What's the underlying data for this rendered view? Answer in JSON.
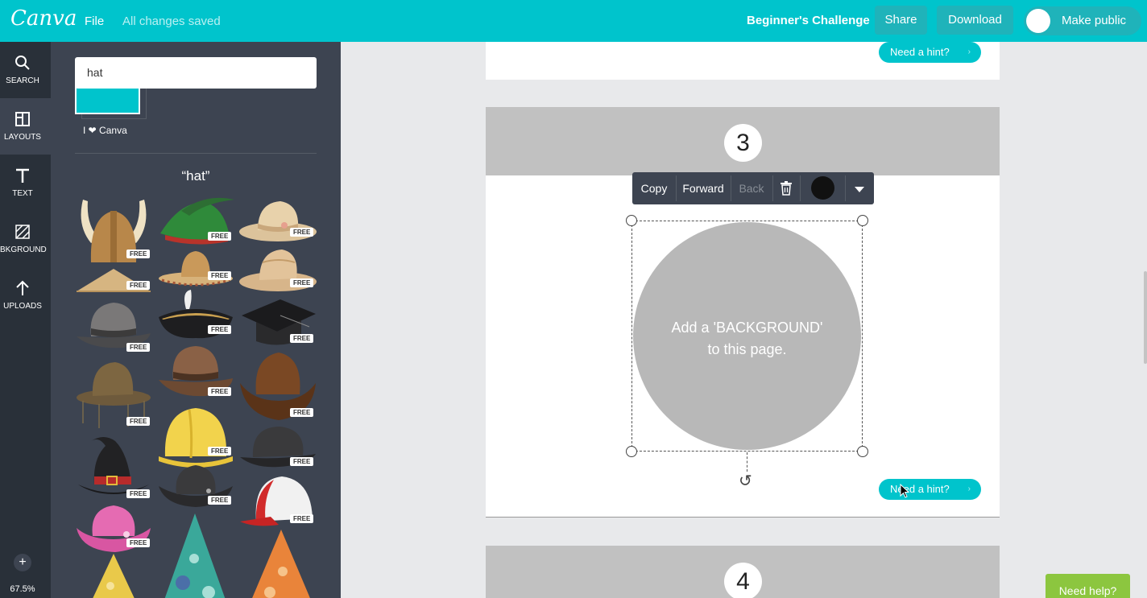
{
  "header": {
    "logo": "Canva",
    "file_label": "File",
    "save_status": "All changes saved",
    "document_title": "Beginner's Challenge",
    "share_label": "Share",
    "download_label": "Download",
    "make_public_label": "Make public"
  },
  "rail": {
    "items": [
      {
        "label": "SEARCH",
        "icon": "search-icon"
      },
      {
        "label": "LAYOUTS",
        "icon": "layouts-icon"
      },
      {
        "label": "TEXT",
        "icon": "text-icon"
      },
      {
        "label": "BKGROUND",
        "icon": "background-icon"
      },
      {
        "label": "UPLOADS",
        "icon": "upload-icon"
      }
    ],
    "zoom_in": "+",
    "zoom_level": "67.5%",
    "zoom_out": "−"
  },
  "panel": {
    "search_value": "hat",
    "heart_label": "I ❤ Canva",
    "results_heading": "“hat”",
    "free_badge": "FREE"
  },
  "canvas": {
    "page3_number": "3",
    "page4_number": "4",
    "hint_label": "Need a hint?",
    "circle_text_line1": "Add a 'BACKGROUND'",
    "circle_text_line2": "to this page.",
    "toolbar": {
      "copy": "Copy",
      "forward": "Forward",
      "back": "Back"
    }
  },
  "help_label": "Need help?",
  "colors": {
    "brand": "#00c4cc",
    "rail": "#293039",
    "panel": "#3d4451",
    "help": "#8cc63f"
  }
}
